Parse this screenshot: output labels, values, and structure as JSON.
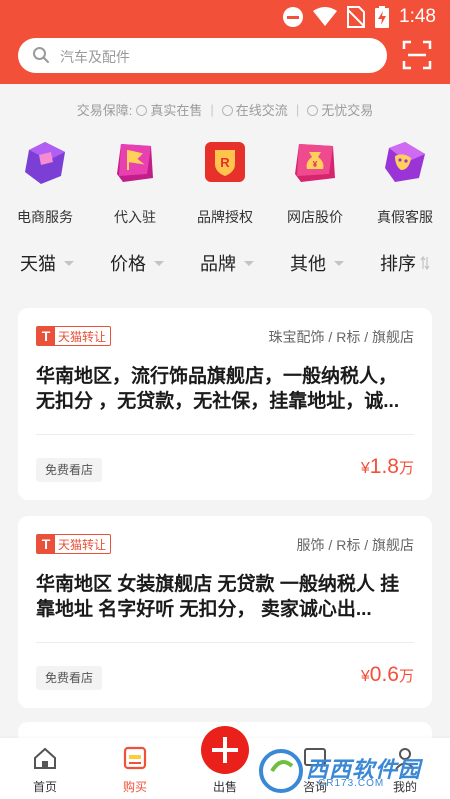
{
  "status": {
    "time": "1:48"
  },
  "search": {
    "placeholder": "汽车及配件"
  },
  "guarantee": {
    "prefix": "交易保障:",
    "items": [
      "真实在售",
      "在线交流",
      "无忧交易"
    ]
  },
  "services": [
    {
      "label": "电商服务",
      "icon": "shop-icon"
    },
    {
      "label": "代入驻",
      "icon": "flag-icon"
    },
    {
      "label": "品牌授权",
      "icon": "r-shield-icon"
    },
    {
      "label": "网店股价",
      "icon": "money-bag-icon"
    },
    {
      "label": "真假客服",
      "icon": "mask-icon"
    }
  ],
  "filters": [
    {
      "label": "天猫"
    },
    {
      "label": "价格"
    },
    {
      "label": "品牌"
    },
    {
      "label": "其他"
    },
    {
      "label": "排序"
    }
  ],
  "listings": [
    {
      "tag": "天猫转让",
      "tag_letter": "T",
      "category": "珠宝配饰 / R标 / 旗舰店",
      "title": "华南地区，流行饰品旗舰店，一般纳税人，无扣分 ，无贷款，无社保，挂靠地址，诚...",
      "free_view": "免费看店",
      "price_symbol": "¥",
      "price_value": "1.8",
      "price_unit": "万"
    },
    {
      "tag": "天猫转让",
      "tag_letter": "T",
      "category": "服饰 / R标 / 旗舰店",
      "title": "华南地区   女装旗舰店 无贷款   一般纳税人   挂靠地址  名字好听     无扣分，   卖家诚心出...",
      "free_view": "免费看店",
      "price_symbol": "¥",
      "price_value": "0.6",
      "price_unit": "万"
    }
  ],
  "bottom_nav": [
    {
      "label": "首页",
      "icon": "home-icon"
    },
    {
      "label": "购买",
      "icon": "buy-icon",
      "active": true
    },
    {
      "label": "出售",
      "icon": "plus-icon"
    },
    {
      "label": "咨询",
      "icon": "message-icon"
    },
    {
      "label": "我的",
      "icon": "user-icon"
    }
  ],
  "watermark": {
    "text": "西西软件园",
    "sub": "CR173.COM"
  },
  "colors": {
    "brand": "#f3503a",
    "tag": "#e9513a",
    "sell": "#e9211a"
  }
}
